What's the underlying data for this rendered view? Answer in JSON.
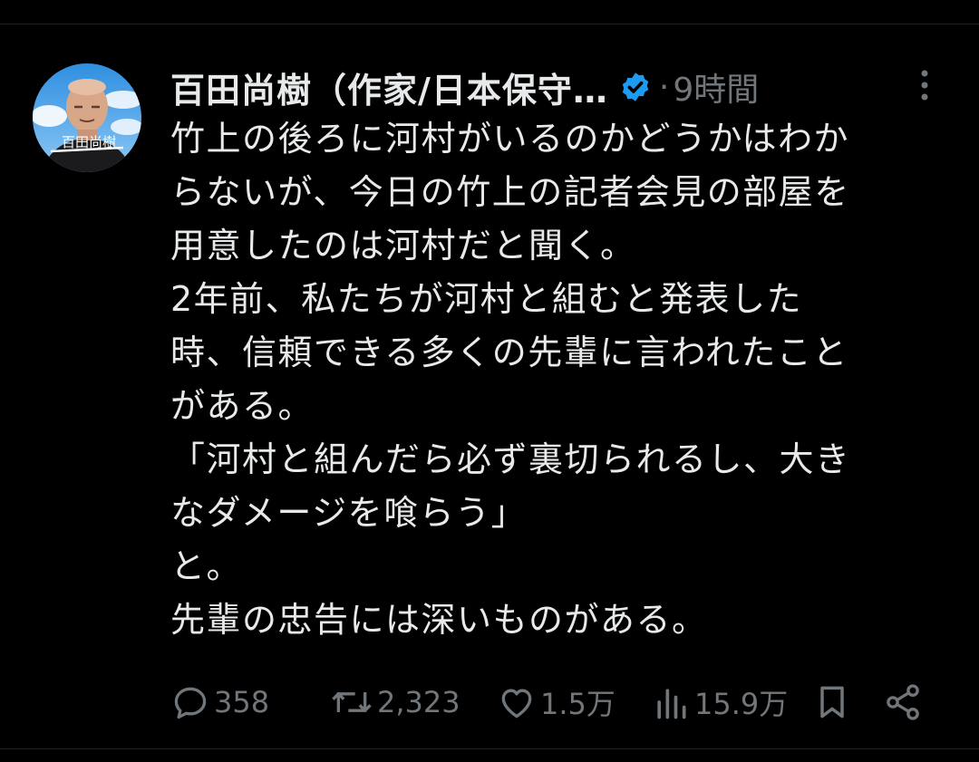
{
  "post": {
    "author_name": "百田尚樹（作家/日本保守…",
    "separator": "·",
    "time": "9時間",
    "avatar_signature": "百田尚樹",
    "lines": [
      "竹上の後ろに河村がいるのかどうかはわか",
      "らないが、今日の竹上の記者会見の部屋を",
      "用意したのは河村だと聞く。",
      "2年前、私たちが河村と組むと発表した",
      "時、信頼できる多くの先輩に言われたこと",
      "がある。",
      "「河村と組んだら必ず裏切られるし、大き",
      "なダメージを喰らう」",
      "と。",
      "先輩の忠告には深いものがある。"
    ]
  },
  "actions": {
    "reply": {
      "icon": "reply-icon",
      "count": "358"
    },
    "repost": {
      "icon": "repost-icon",
      "count": "2,323"
    },
    "like": {
      "icon": "heart-icon",
      "count": "1.5万"
    },
    "views": {
      "icon": "views-icon",
      "count": "15.9万"
    },
    "bookmark": {
      "icon": "bookmark-icon"
    },
    "share": {
      "icon": "share-icon"
    }
  },
  "colors": {
    "background": "#000000",
    "text": "#e7e9ea",
    "muted": "#71767b",
    "verified": "#1d9bf0"
  }
}
